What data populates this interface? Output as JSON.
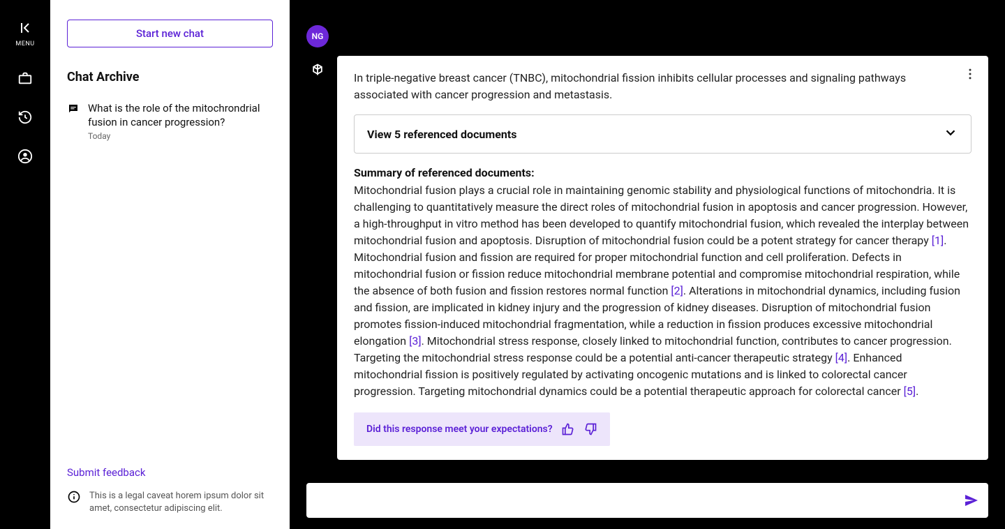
{
  "rail": {
    "menu_label": "MENU"
  },
  "sidebar": {
    "start_chat_label": "Start new chat",
    "archive_title": "Chat Archive",
    "items": [
      {
        "title": "What is the role of the mitochrondrial fusion in cancer progression?",
        "date": "Today"
      }
    ],
    "submit_feedback": "Submit feedback",
    "caveat": "This is a legal caveat horem ipsum dolor sit amet, consectetur adipiscing elit."
  },
  "chat": {
    "user_avatar": "NG",
    "response": {
      "intro": "In triple-negative breast cancer (TNBC), mitochondrial fission inhibits cellular processes and signaling pathways associated with cancer progression and metastasis.",
      "references_toggle": "View 5 referenced documents",
      "summary_heading": "Summary of referenced documents:",
      "summary_parts": {
        "p1": "Mitochondrial fusion plays a crucial role in maintaining genomic stability and physiological functions of mitochondria. It is challenging to quantitatively measure the direct roles of mitochondrial fusion in apoptosis and cancer progression. However, a high-throughput in vitro method has been developed to quantify mitochondrial fusion, which revealed the interplay between mitochondrial fusion and apoptosis. Disruption of mitochondrial fusion could be a potent strategy for cancer therapy ",
        "c1": "[1]",
        "p2": ". Mitochondrial fusion and fission are required for proper mitochondrial function and cell proliferation. Defects in mitochondrial fusion or fission reduce mitochondrial membrane potential and compromise mitochondrial respiration, while the absence of both fusion and fission restores normal function ",
        "c2": "[2]",
        "p3": ". Alterations in mitochondrial dynamics, including fusion and fission, are implicated in kidney injury and the progression of kidney diseases. Disruption of mitochondrial fusion promotes fission-induced mitochondrial fragmentation, while a reduction in fission produces excessive mitochondrial elongation ",
        "c3": "[3]",
        "p4": ". Mitochondrial stress response, closely linked to mitochondrial function, contributes to cancer progression. Targeting the mitochondrial stress response could be a potential anti-cancer therapeutic strategy ",
        "c4": "[4]",
        "p5": ". Enhanced mitochondrial fission is positively regulated by activating oncogenic mutations and is linked to colorectal cancer progression. Targeting mitochondrial dynamics could be a potential therapeutic approach for colorectal cancer ",
        "c5": "[5]",
        "p6": "."
      },
      "feedback_prompt": "Did this response meet your expectations?"
    }
  },
  "input": {
    "placeholder": ""
  }
}
